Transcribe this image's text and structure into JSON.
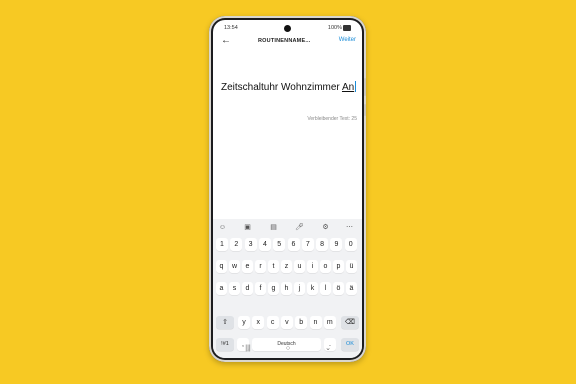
{
  "status_bar": {
    "time": "13:54",
    "battery": "100%"
  },
  "app_bar": {
    "title": "ROUTINENNAME...",
    "action_label": "Weiter",
    "back_icon": "arrow-left-icon"
  },
  "input": {
    "value_prefix": "Zeitschaltuhr Wohnzimmer ",
    "value_typed": "An"
  },
  "remaining_text": "Verbleibender Text: 25",
  "keyboard_toolbar": [
    "emoji-icon",
    "clipboard-icon",
    "sticker-icon",
    "microphone-icon",
    "settings-gear-icon",
    "more-icon"
  ],
  "keyboard": {
    "numbers": [
      "1",
      "2",
      "3",
      "4",
      "5",
      "6",
      "7",
      "8",
      "9",
      "0"
    ],
    "row1": [
      "q",
      "w",
      "e",
      "r",
      "t",
      "z",
      "u",
      "i",
      "o",
      "p",
      "ü"
    ],
    "row2": [
      "a",
      "s",
      "d",
      "f",
      "g",
      "h",
      "j",
      "k",
      "l",
      "ö",
      "ä"
    ],
    "row3": [
      "y",
      "x",
      "c",
      "v",
      "b",
      "n",
      "m"
    ],
    "shift_icon": "shift-arrow-icon",
    "backspace_icon": "backspace-icon",
    "symbols_label": "!#1",
    "comma_label": ",",
    "space_label": "Deutsch",
    "period_label": ".",
    "ok_label": "OK"
  },
  "nav_bar": [
    "recent-apps-icon",
    "home-icon",
    "back-chevron-icon"
  ]
}
